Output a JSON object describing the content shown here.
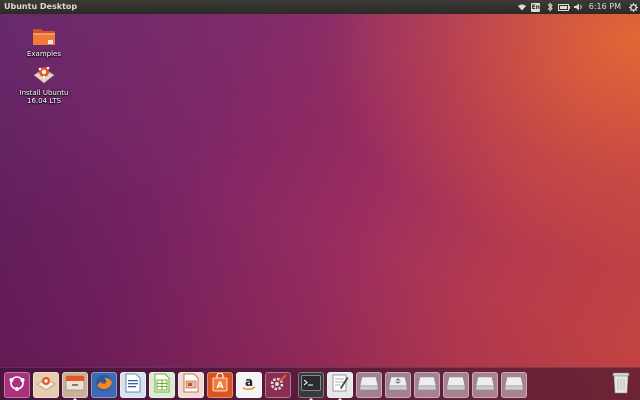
{
  "top_panel": {
    "title": "Ubuntu Desktop",
    "clock": "6:16 PM",
    "keyboard_layout": "En",
    "indicators": [
      "network-icon",
      "keyboard-layout-indicator",
      "bluetooth-icon",
      "battery-icon",
      "volume-icon",
      "clock",
      "session-gear-icon"
    ]
  },
  "desktop": {
    "icons": [
      {
        "id": "examples",
        "label": "Examples",
        "icon": "folder-icon"
      },
      {
        "id": "install",
        "label_line1": "Install Ubuntu",
        "label_line2": "16.04 LTS",
        "icon": "installer-icon"
      }
    ]
  },
  "launcher": {
    "items": [
      {
        "id": "dash",
        "icon": "ubuntu-logo-icon",
        "running": false
      },
      {
        "id": "install-ubuntu",
        "icon": "installer-icon",
        "running": false
      },
      {
        "id": "files",
        "icon": "file-cabinet-icon",
        "running": true
      },
      {
        "id": "firefox",
        "icon": "firefox-icon",
        "running": false
      },
      {
        "id": "writer",
        "icon": "writer-icon",
        "running": false
      },
      {
        "id": "calc",
        "icon": "calc-icon",
        "running": false
      },
      {
        "id": "impress",
        "icon": "impress-icon",
        "running": false
      },
      {
        "id": "software",
        "icon": "software-center-icon",
        "running": false
      },
      {
        "id": "amazon",
        "icon": "amazon-icon",
        "running": false
      },
      {
        "id": "settings",
        "icon": "system-settings-icon",
        "running": false
      },
      {
        "id": "terminal",
        "icon": "terminal-icon",
        "running": true
      },
      {
        "id": "editor",
        "icon": "text-editor-icon",
        "running": true
      },
      {
        "id": "drive1",
        "icon": "drive-icon",
        "running": false
      },
      {
        "id": "usb",
        "icon": "usb-drive-icon",
        "running": false
      },
      {
        "id": "drive2",
        "icon": "drive-icon",
        "running": false
      },
      {
        "id": "drive3",
        "icon": "drive-icon",
        "running": false
      },
      {
        "id": "drive4",
        "icon": "drive-icon",
        "running": false
      },
      {
        "id": "drive5",
        "icon": "drive-icon",
        "running": false
      }
    ],
    "trash": {
      "icon": "trash-icon"
    }
  },
  "colors": {
    "panel": "#2b2a27",
    "ubuntu_orange": "#e95420",
    "wallpaper_purple": "#5e1f63"
  }
}
